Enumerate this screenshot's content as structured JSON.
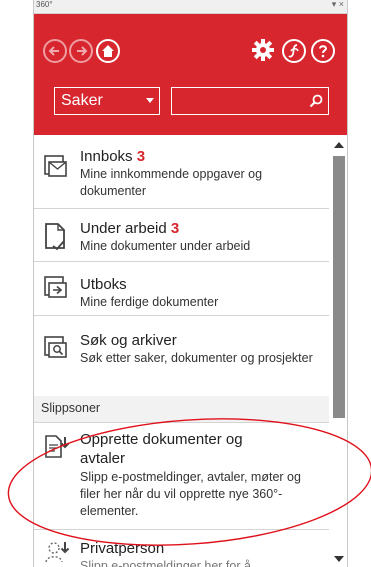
{
  "window": {
    "title": "360°",
    "controls": "▾ ×"
  },
  "toolbar": {
    "back_icon": "back-arrow-icon",
    "forward_icon": "forward-arrow-icon",
    "home_icon": "home-icon",
    "settings_icon": "gear-icon",
    "link_icon": "link-icon",
    "help_icon": "help-icon"
  },
  "search": {
    "scope_value": "Saker",
    "query": ""
  },
  "items": [
    {
      "title": "Innboks",
      "count": "3",
      "desc": "Mine innkommende oppgaver og dokumenter",
      "icon": "inbox-icon"
    },
    {
      "title": "Under arbeid",
      "count": "3",
      "desc": "Mine dokumenter under arbeid",
      "icon": "document-check-icon"
    },
    {
      "title": "Utboks",
      "count": "",
      "desc": "Mine ferdige dokumenter",
      "icon": "outbox-icon"
    },
    {
      "title": "Søk og arkiver",
      "count": "",
      "desc": "Søk etter saker, dokumenter og prosjekter",
      "icon": "archive-search-icon"
    }
  ],
  "section": {
    "label": "Slippsoner"
  },
  "dropzones": [
    {
      "title_line1": "Opprette dokumenter og",
      "title_line2": "avtaler",
      "desc": "Slipp e-postmeldinger, avtaler, møter og filer her når du vil opprette nye 360°-elementer.",
      "icon": "create-document-icon"
    },
    {
      "title_line1": "Privatperson",
      "desc": "Slipp e-postmeldinger her for å",
      "icon": "person-icon"
    }
  ],
  "colors": {
    "brand": "#d7262e",
    "count": "#d7262e"
  }
}
